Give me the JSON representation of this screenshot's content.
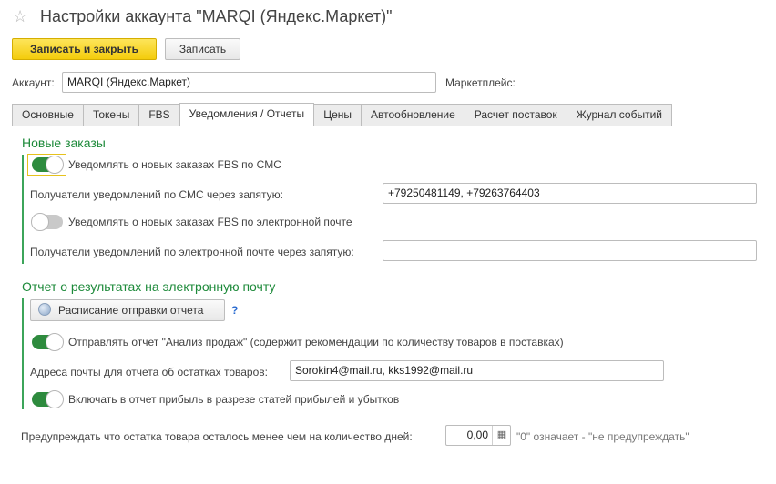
{
  "window": {
    "title": "Настройки аккаунта \"MARQI (Яндекс.Маркет)\"",
    "star_icon": "star-icon"
  },
  "toolbar": {
    "save_close_label": "Записать и закрыть",
    "save_label": "Записать"
  },
  "account": {
    "label": "Аккаунт:",
    "value": "MARQI (Яндекс.Маркет)",
    "marketplace_label": "Маркетплейс:"
  },
  "tabs": [
    "Основные",
    "Токены",
    "FBS",
    "Уведомления / Отчеты",
    "Цены",
    "Автообновление",
    "Расчет поставок",
    "Журнал событий"
  ],
  "active_tab": "Уведомления / Отчеты",
  "new_orders": {
    "heading": "Новые заказы",
    "sms_toggle_label": "Уведомлять о новых заказах FBS по СМС",
    "sms_toggle_on": true,
    "sms_recipients_label": "Получатели уведомлений по СМС через запятую:",
    "sms_recipients_value": "+79250481149, +79263764403",
    "email_toggle_label": "Уведомлять о новых заказах FBS по электронной почте",
    "email_toggle_on": false,
    "email_recipients_label": "Получатели уведомлений по электронной почте через запятую:",
    "email_recipients_value": ""
  },
  "report": {
    "heading": "Отчет о результатах на электронную почту",
    "schedule_button": "Расписание отправки отчета",
    "help": "?",
    "sales_toggle_label": "Отправлять отчет \"Анализ продаж\" (содержит рекомендации по количеству товаров в поставках)",
    "sales_toggle_on": true,
    "stock_emails_label": "Адреса почты для отчета об остатках товаров:",
    "stock_emails_value": "Sorokin4@mail.ru,  kks1992@mail.ru",
    "profit_toggle_label": "Включать в отчет прибыль в разрезе статей прибылей и убытков",
    "profit_toggle_on": true
  },
  "warning": {
    "label": "Предупреждать что остатка товара осталось менее чем на количество дней:",
    "value": "0,00",
    "hint": "\"0\" означает - \"не предупреждать\""
  },
  "colors": {
    "accent_green": "#1d8a3a",
    "toggle_on": "#2e8b3e",
    "primary_button": "#f4cc0c"
  }
}
